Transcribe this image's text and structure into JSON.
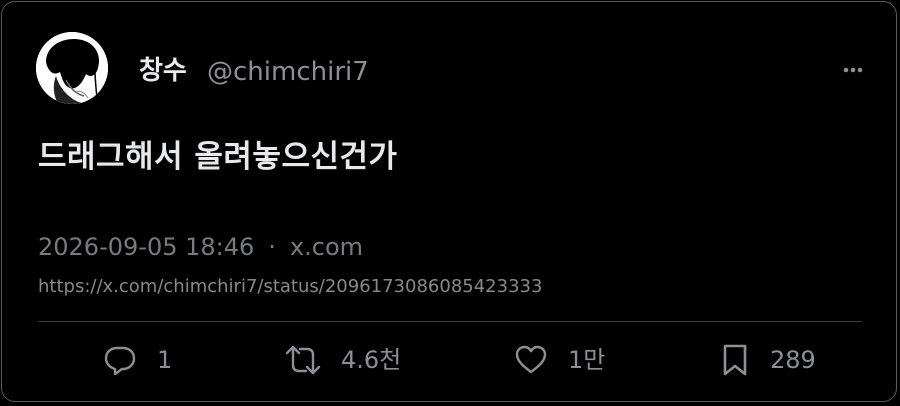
{
  "author": {
    "display_name": "창수",
    "handle": "@chimchiri7"
  },
  "tweet": {
    "text": "드래그해서 올려놓으신건가"
  },
  "meta": {
    "timestamp": "2026-09-05 18:46",
    "separator": "·",
    "source": "x.com",
    "url": "https://x.com/chimchiri7/status/2096173086085423333"
  },
  "actions": {
    "reply_count": "1",
    "retweet_count": "4.6천",
    "like_count": "1만",
    "bookmark_count": "289"
  },
  "icons": {
    "more": "more-horizontal-icon",
    "reply": "reply-icon",
    "retweet": "retweet-icon",
    "like": "heart-icon",
    "bookmark": "bookmark-icon"
  },
  "colors": {
    "background": "#000000",
    "text_primary": "#e7e9ea",
    "text_secondary": "#8b9096",
    "border": "#5a5a5a"
  }
}
